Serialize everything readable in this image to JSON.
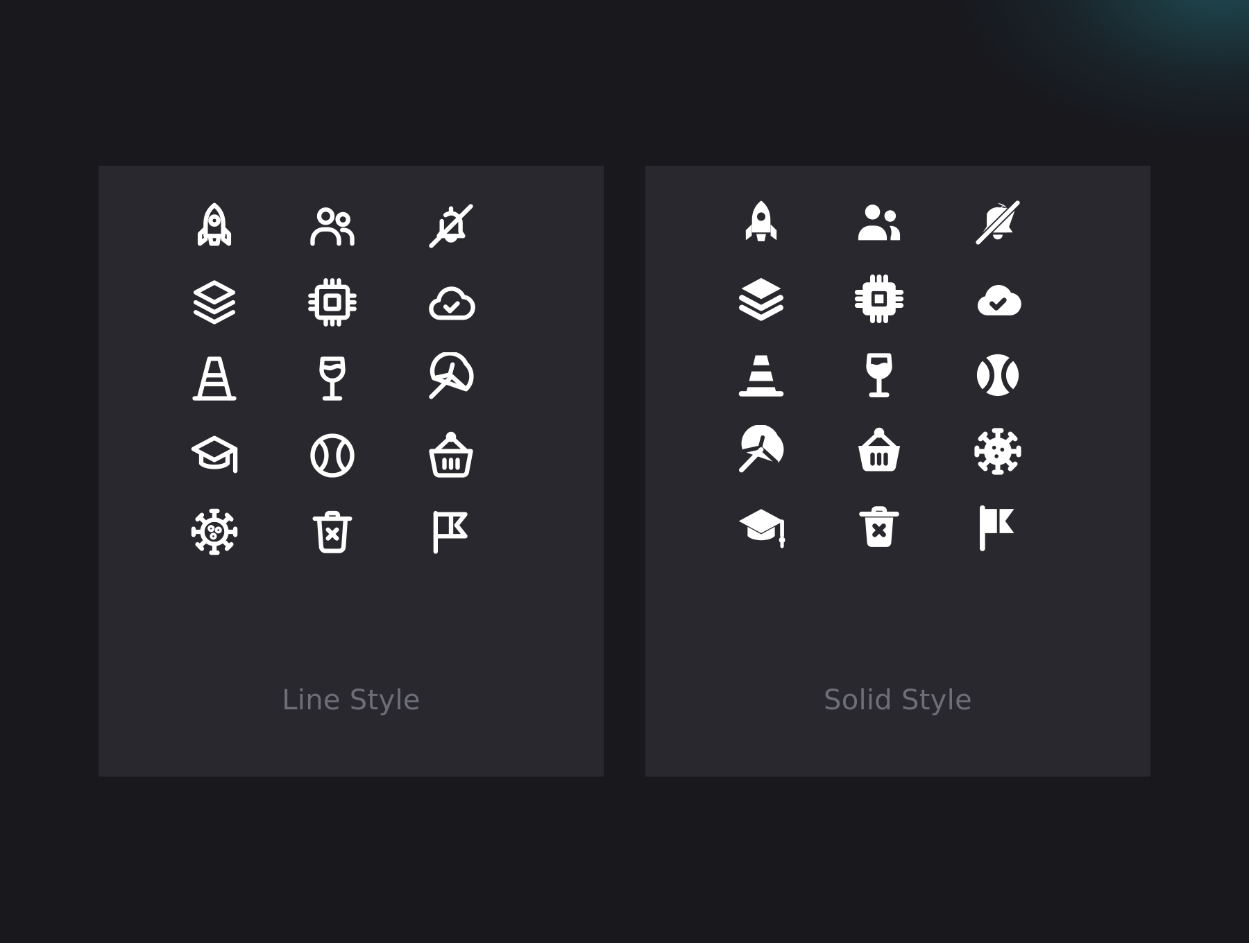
{
  "panels": {
    "line": {
      "caption": "Line Style",
      "icons": [
        "rocket",
        "users",
        "bell-off",
        "layers",
        "cpu",
        "cloud-check",
        "traffic-cone",
        "wine-glass",
        "umbrella",
        "graduation-cap",
        "tennis-ball",
        "basket",
        "virus",
        "trash-x",
        "flag"
      ]
    },
    "solid": {
      "caption": "Solid Style",
      "icons": [
        "rocket",
        "users",
        "bell-off",
        "layers",
        "cpu",
        "cloud-check",
        "traffic-cone",
        "wine-glass",
        "tennis-ball",
        "umbrella",
        "basket",
        "virus",
        "graduation-cap",
        "trash-x",
        "flag"
      ]
    }
  },
  "colors": {
    "background": "#18181d",
    "panel": "#28282e",
    "icon": "#ffffff",
    "caption": "#6e6e76",
    "glow": "#246e78"
  }
}
